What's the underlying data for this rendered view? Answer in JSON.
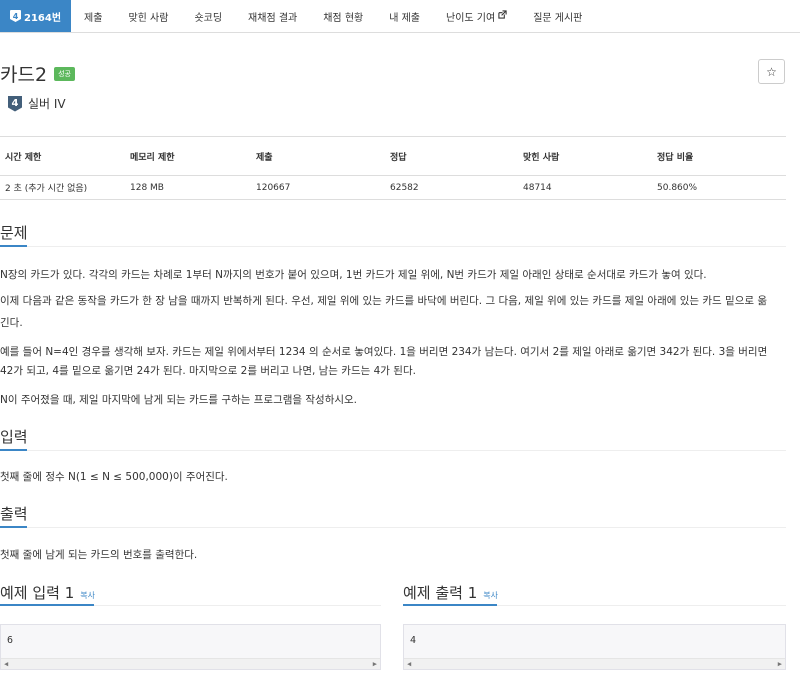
{
  "nav": {
    "tabs": [
      {
        "label": "2164번",
        "tier": "4"
      },
      {
        "label": "제출"
      },
      {
        "label": "맞힌 사람"
      },
      {
        "label": "숏코딩"
      },
      {
        "label": "재채점 결과"
      },
      {
        "label": "채점 현황"
      },
      {
        "label": "내 제출"
      },
      {
        "label": "난이도 기여"
      },
      {
        "label": "질문 게시판"
      }
    ]
  },
  "problem": {
    "title": "카드2",
    "status_badge": "성공",
    "star": "☆",
    "tier_number": "4",
    "tier_label": "실버 IV"
  },
  "info_table": {
    "headers": [
      "시간 제한",
      "메모리 제한",
      "제출",
      "정답",
      "맞힌 사람",
      "정답 비율"
    ],
    "row": [
      "2 초 (추가 시간 없음)",
      "128 MB",
      "120667",
      "62582",
      "48714",
      "50.860%"
    ]
  },
  "sections": {
    "problem_heading": "문제",
    "problem_lines": [
      "N장의 카드가 있다. 각각의 카드는 차례로 1부터 N까지의 번호가 붙어 있으며, 1번 카드가 제일 위에, N번 카드가 제일 아래인 상태로 순서대로 카드가 놓여 있다.",
      "이제 다음과 같은 동작을 카드가 한 장 남을 때까지 반복하게 된다. 우선, 제일 위에 있는 카드를 바닥에 버린다. 그 다음, 제일 위에 있는 카드를 제일 아래에 있는 카드 밑으로 옮",
      "긴다.",
      "예를 들어 N=4인 경우를 생각해 보자. 카드는 제일 위에서부터 1234 의 순서로 놓여있다. 1을 버리면 234가 남는다. 여기서 2를 제일 아래로 옮기면 342가 된다. 3을 버리면",
      "42가 되고, 4를 밑으로 옮기면 24가 된다. 마지막으로 2를 버리고 나면, 남는 카드는 4가 된다.",
      "N이 주어졌을 때, 제일 마지막에 남게 되는 카드를 구하는 프로그램을 작성하시오."
    ],
    "input_heading": "입력",
    "input_text": "첫째 줄에 정수 N(1 ≤ N ≤ 500,000)이 주어진다.",
    "output_heading": "출력",
    "output_text": "첫째 줄에 남게 되는 카드의 번호를 출력한다."
  },
  "samples": {
    "input_heading": "예제 입력 1",
    "output_heading": "예제 출력 1",
    "copy_label": "복사",
    "input_value": "6",
    "output_value": "4"
  }
}
